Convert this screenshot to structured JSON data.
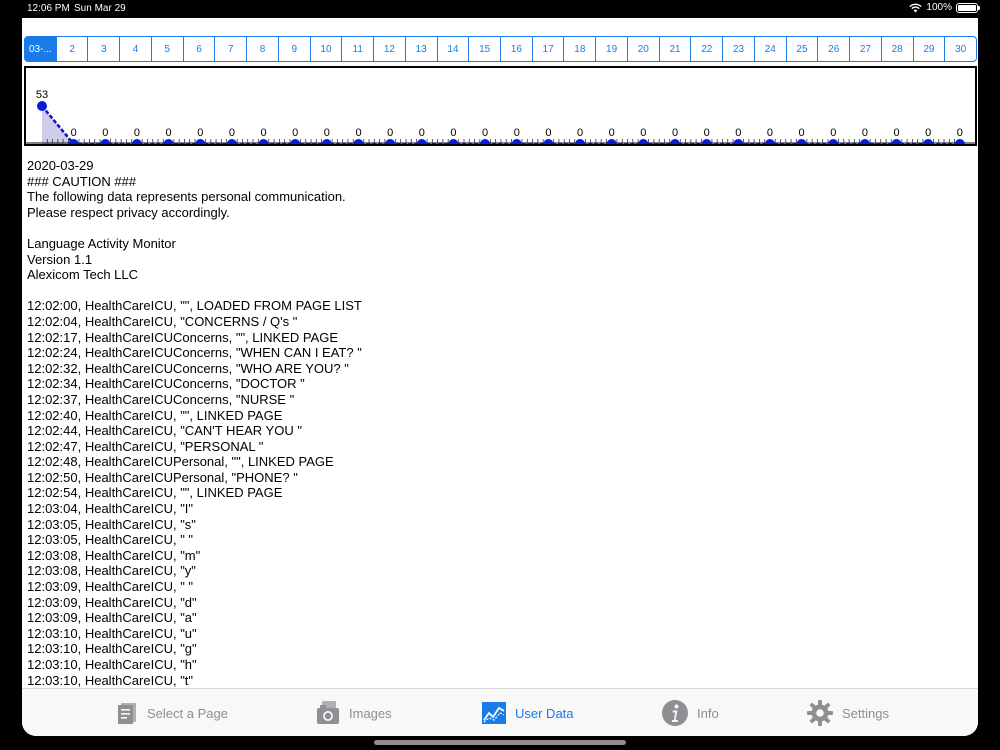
{
  "status": {
    "time": "12:06 PM",
    "date": "Sun Mar 29",
    "battery": "100%"
  },
  "segments": [
    "03-...",
    "2",
    "3",
    "4",
    "5",
    "6",
    "7",
    "8",
    "9",
    "10",
    "11",
    "12",
    "13",
    "14",
    "15",
    "16",
    "17",
    "18",
    "19",
    "20",
    "21",
    "22",
    "23",
    "24",
    "25",
    "26",
    "27",
    "28",
    "29",
    "30"
  ],
  "selected_segment": 0,
  "chart_data": {
    "type": "line",
    "categories": [
      "03-...",
      "2",
      "3",
      "4",
      "5",
      "6",
      "7",
      "8",
      "9",
      "10",
      "11",
      "12",
      "13",
      "14",
      "15",
      "16",
      "17",
      "18",
      "19",
      "20",
      "21",
      "22",
      "23",
      "24",
      "25",
      "26",
      "27",
      "28",
      "29",
      "30"
    ],
    "values": [
      53,
      0,
      0,
      0,
      0,
      0,
      0,
      0,
      0,
      0,
      0,
      0,
      0,
      0,
      0,
      0,
      0,
      0,
      0,
      0,
      0,
      0,
      0,
      0,
      0,
      0,
      0,
      0,
      0,
      0
    ],
    "ylim": [
      0,
      53
    ],
    "colors": {
      "line": "#1010c0",
      "marker": "#0a1ad8",
      "fill": "#c8c8e8"
    }
  },
  "log_lines": [
    "2020-03-29",
    "### CAUTION ###",
    "The following data represents personal communication.",
    "Please respect privacy accordingly.",
    "",
    "Language Activity Monitor",
    "Version 1.1",
    "Alexicom Tech LLC",
    "",
    "12:02:00, HealthCareICU, \"\", LOADED FROM PAGE LIST",
    "12:02:04, HealthCareICU, \"CONCERNS / Q's \"",
    "12:02:17, HealthCareICUConcerns, \"\", LINKED PAGE",
    "12:02:24, HealthCareICUConcerns, \"WHEN CAN I EAT? \"",
    "12:02:32, HealthCareICUConcerns, \"WHO ARE YOU? \"",
    "12:02:34, HealthCareICUConcerns, \"DOCTOR \"",
    "12:02:37, HealthCareICUConcerns, \"NURSE \"",
    "12:02:40, HealthCareICU, \"\", LINKED PAGE",
    "12:02:44, HealthCareICU, \"CAN'T HEAR YOU \"",
    "12:02:47, HealthCareICU, \"PERSONAL \"",
    "12:02:48, HealthCareICUPersonal, \"\", LINKED PAGE",
    "12:02:50, HealthCareICUPersonal, \"PHONE? \"",
    "12:02:54, HealthCareICU, \"\", LINKED PAGE",
    "12:03:04, HealthCareICU, \"I\"",
    "12:03:05, HealthCareICU, \"s\"",
    "12:03:05, HealthCareICU, \" \"",
    "12:03:08, HealthCareICU, \"m\"",
    "12:03:08, HealthCareICU, \"y\"",
    "12:03:09, HealthCareICU, \" \"",
    "12:03:09, HealthCareICU, \"d\"",
    "12:03:09, HealthCareICU, \"a\"",
    "12:03:10, HealthCareICU, \"u\"",
    "12:03:10, HealthCareICU, \"g\"",
    "12:03:10, HealthCareICU, \"h\"",
    "12:03:10, HealthCareICU, \"t\""
  ],
  "tabs": [
    {
      "label": "Select a Page",
      "icon": "pages-icon"
    },
    {
      "label": "Images",
      "icon": "camera-icon"
    },
    {
      "label": "User Data",
      "icon": "chart-icon"
    },
    {
      "label": "Info",
      "icon": "info-icon"
    },
    {
      "label": "Settings",
      "icon": "gear-icon"
    }
  ],
  "active_tab": 2,
  "colors": {
    "accent": "#1a7be8",
    "inactive": "#8e8e93"
  }
}
